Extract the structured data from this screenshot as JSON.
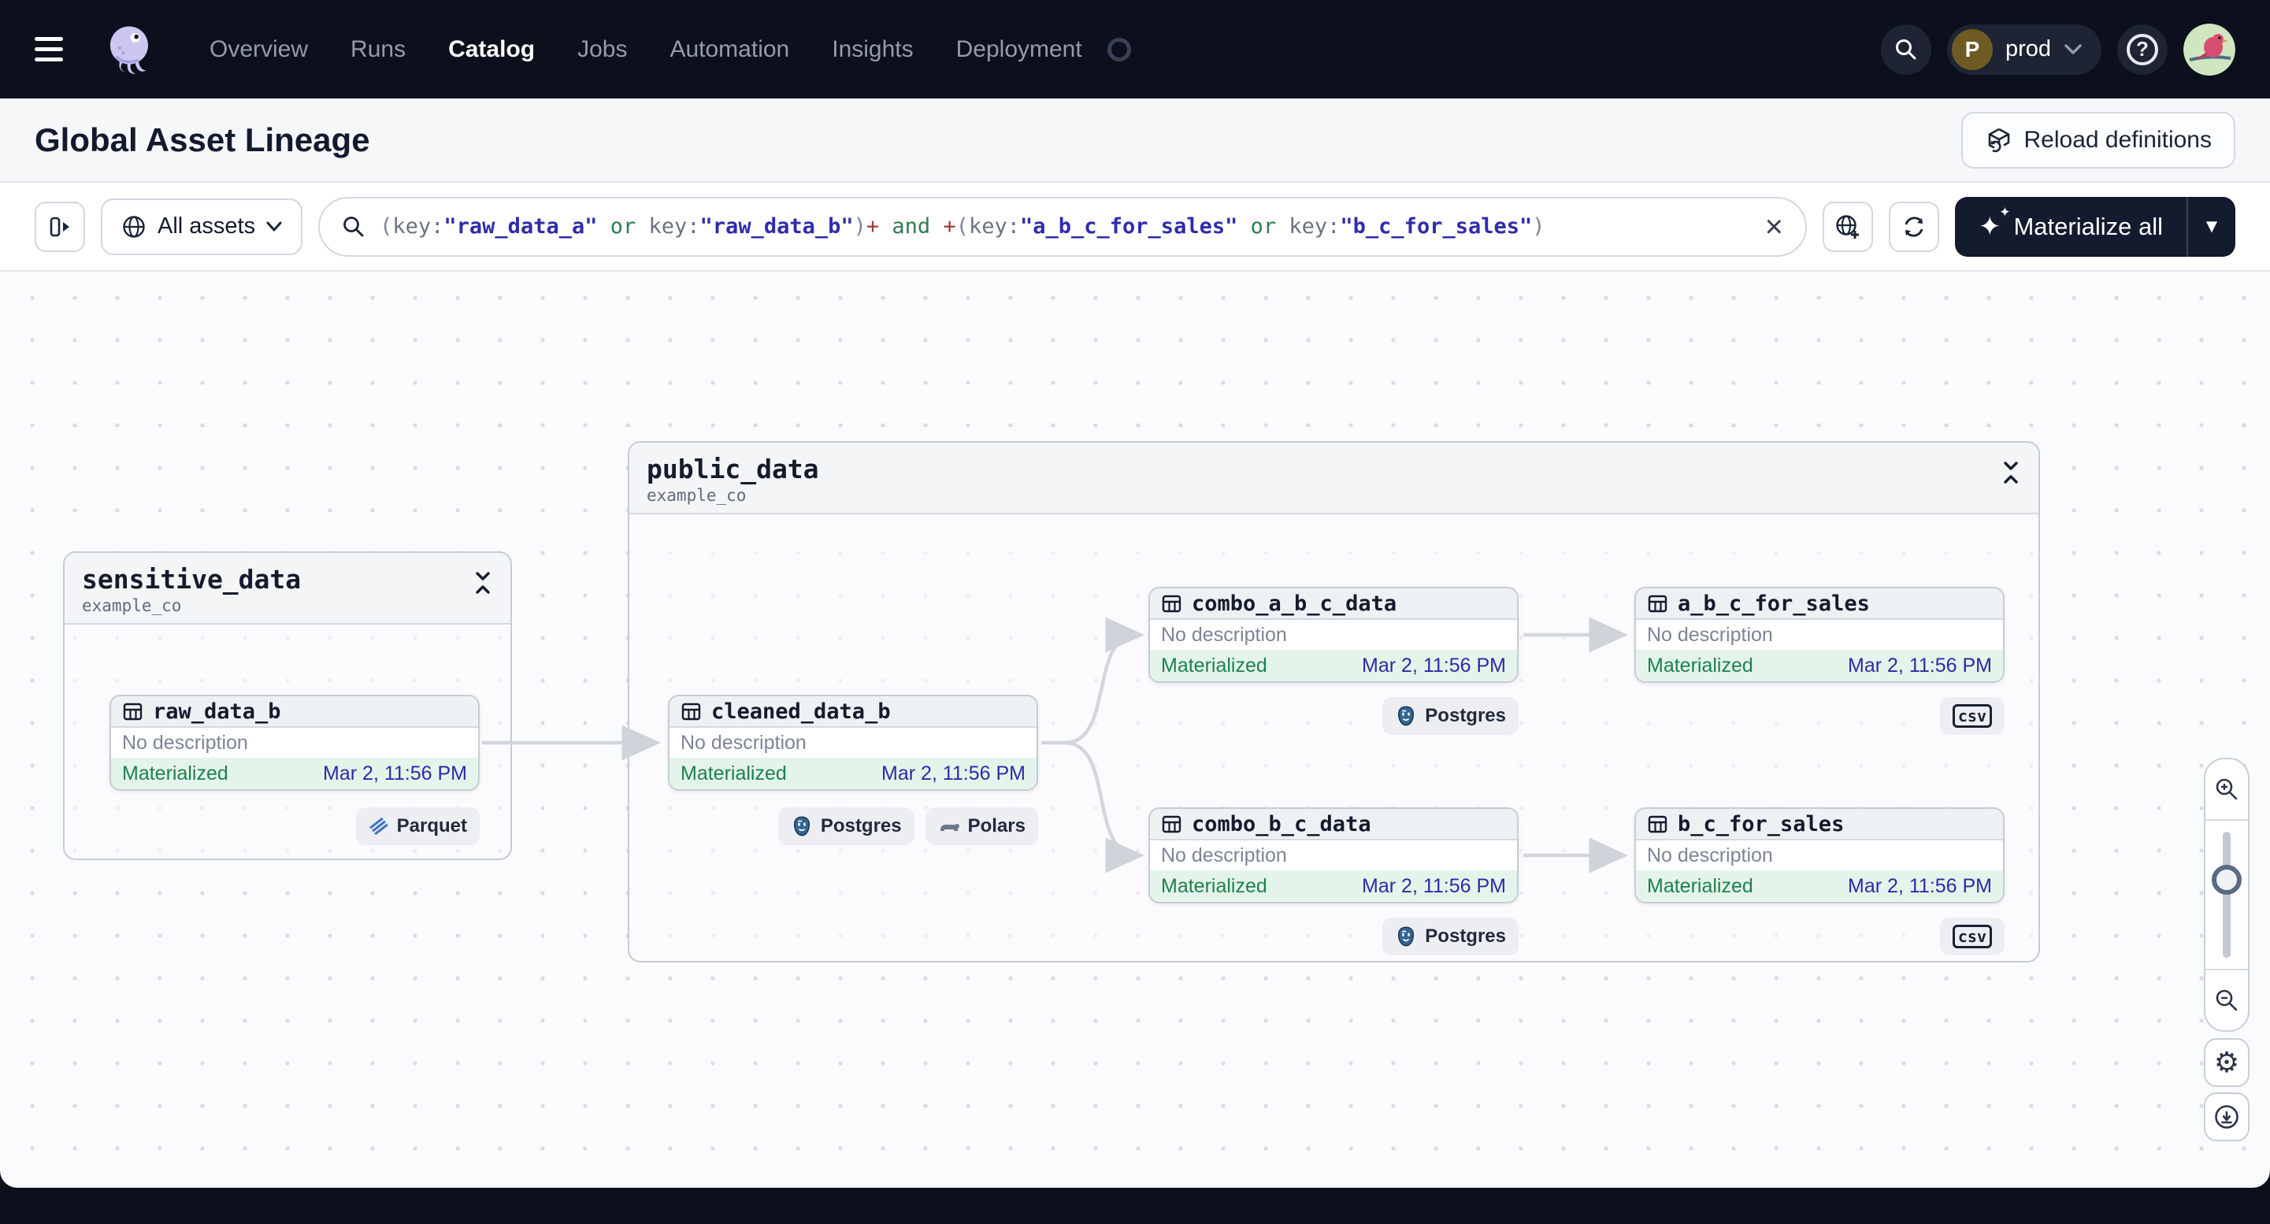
{
  "nav": {
    "logo_icon": "dagster-octopus-logo",
    "items": [
      {
        "label": "Overview",
        "active": false
      },
      {
        "label": "Runs",
        "active": false
      },
      {
        "label": "Catalog",
        "active": true
      },
      {
        "label": "Jobs",
        "active": false
      },
      {
        "label": "Automation",
        "active": false
      },
      {
        "label": "Insights",
        "active": false
      },
      {
        "label": "Deployment",
        "active": false
      }
    ],
    "environment": {
      "initial": "P",
      "name": "prod"
    },
    "icons": [
      "search-icon",
      "chevron-down-icon",
      "help-icon",
      "user-avatar"
    ]
  },
  "page_header": {
    "title": "Global Asset Lineage",
    "reload_button": "Reload definitions"
  },
  "toolbar": {
    "asset_filter": {
      "label": "All assets",
      "icon": "globe-icon"
    },
    "search": {
      "icon": "search-icon",
      "clear_icon": "clear-x-icon",
      "query_plain": "(key:\"raw_data_a\" or key:\"raw_data_b\")+ and +(key:\"a_b_c_for_sales\" or key:\"b_c_for_sales\")",
      "segments": [
        {
          "text": "(",
          "type": "punct"
        },
        {
          "text": "key:",
          "type": "key"
        },
        {
          "text": "\"raw_data_a\"",
          "type": "string"
        },
        {
          "text": " or ",
          "type": "operator"
        },
        {
          "text": "key:",
          "type": "key"
        },
        {
          "text": "\"raw_data_b\"",
          "type": "string"
        },
        {
          "text": ")",
          "type": "punct"
        },
        {
          "text": "+",
          "type": "plus"
        },
        {
          "text": " and ",
          "type": "operator"
        },
        {
          "text": "+",
          "type": "plus"
        },
        {
          "text": "(",
          "type": "punct"
        },
        {
          "text": "key:",
          "type": "key"
        },
        {
          "text": "\"a_b_c_for_sales\"",
          "type": "string"
        },
        {
          "text": " or ",
          "type": "operator"
        },
        {
          "text": "key:",
          "type": "key"
        },
        {
          "text": "\"b_c_for_sales\"",
          "type": "string"
        },
        {
          "text": ")",
          "type": "punct"
        }
      ]
    },
    "other_icons": [
      "globe-add-icon",
      "refresh-icon"
    ],
    "materialize_button": "Materialize all"
  },
  "graph": {
    "groups": [
      {
        "name": "sensitive_data",
        "subtitle": "example_co"
      },
      {
        "name": "public_data",
        "subtitle": "example_co"
      }
    ],
    "nodes": [
      {
        "name": "raw_data_b",
        "description": "No description",
        "status": "Materialized",
        "timestamp": "Mar 2, 11:56 PM",
        "badges": [
          {
            "icon": "parquet-icon",
            "label": "Parquet"
          }
        ]
      },
      {
        "name": "cleaned_data_b",
        "description": "No description",
        "status": "Materialized",
        "timestamp": "Mar 2, 11:56 PM",
        "badges": [
          {
            "icon": "postgres-icon",
            "label": "Postgres"
          },
          {
            "icon": "polars-icon",
            "label": "Polars"
          }
        ]
      },
      {
        "name": "combo_a_b_c_data",
        "description": "No description",
        "status": "Materialized",
        "timestamp": "Mar 2, 11:56 PM",
        "badges": [
          {
            "icon": "postgres-icon",
            "label": "Postgres"
          }
        ]
      },
      {
        "name": "a_b_c_for_sales",
        "description": "No description",
        "status": "Materialized",
        "timestamp": "Mar 2, 11:56 PM",
        "badges": [
          {
            "icon": "csv-icon",
            "label": "csv"
          }
        ]
      },
      {
        "name": "combo_b_c_data",
        "description": "No description",
        "status": "Materialized",
        "timestamp": "Mar 2, 11:56 PM",
        "badges": [
          {
            "icon": "postgres-icon",
            "label": "Postgres"
          }
        ]
      },
      {
        "name": "b_c_for_sales",
        "description": "No description",
        "status": "Materialized",
        "timestamp": "Mar 2, 11:56 PM",
        "badges": [
          {
            "icon": "csv-icon",
            "label": "csv"
          }
        ]
      }
    ],
    "edges": [
      {
        "from": "raw_data_b",
        "to": "cleaned_data_b"
      },
      {
        "from": "cleaned_data_b",
        "to": "combo_a_b_c_data"
      },
      {
        "from": "cleaned_data_b",
        "to": "combo_b_c_data"
      },
      {
        "from": "combo_a_b_c_data",
        "to": "a_b_c_for_sales"
      },
      {
        "from": "combo_b_c_data",
        "to": "b_c_for_sales"
      }
    ],
    "zoom_controls": [
      "zoom-in-icon",
      "zoom-slider",
      "zoom-out-icon",
      "settings-gear-icon",
      "download-icon"
    ]
  },
  "colors": {
    "nav_background": "#0c0f1c",
    "materialized_green": "#1d8150",
    "timestamp_indigo": "#2c2ba6",
    "query_string": "#2f2cab",
    "query_operator": "#2e7d4f",
    "query_plus": "#9e3b32",
    "edge_gray": "#d2d6dd"
  }
}
